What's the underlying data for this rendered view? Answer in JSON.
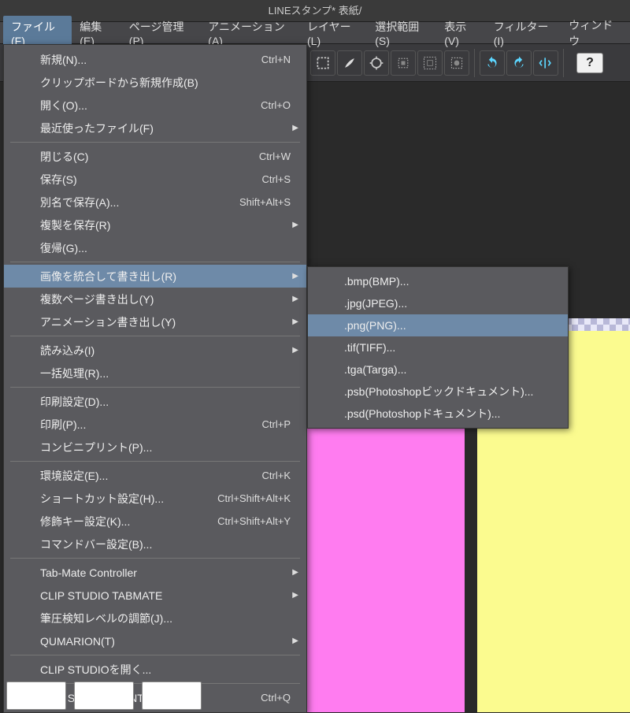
{
  "title": "LINEスタンプ* 表紙/",
  "menubar": {
    "items": [
      {
        "label": "ファイル(F)",
        "active": true
      },
      {
        "label": "編集(E)"
      },
      {
        "label": "ページ管理(P)"
      },
      {
        "label": "アニメーション(A)"
      },
      {
        "label": "レイヤー(L)"
      },
      {
        "label": "選択範囲(S)"
      },
      {
        "label": "表示(V)"
      },
      {
        "label": "フィルター(I)"
      },
      {
        "label": "ウィンドウ"
      }
    ]
  },
  "toolbar": {
    "icons": [
      "marquee-icon",
      "brush-icon",
      "free-transform-icon",
      "shrink-selection-icon",
      "expand-selection-icon",
      "quick-mask-icon"
    ],
    "icons2": [
      "rotate-left-icon",
      "rotate-right-icon",
      "flip-icon"
    ],
    "help": "?"
  },
  "file_menu": {
    "groups": [
      [
        {
          "label": "新規(N)...",
          "shortcut": "Ctrl+N"
        },
        {
          "label": "クリップボードから新規作成(B)"
        },
        {
          "label": "開く(O)...",
          "shortcut": "Ctrl+O"
        },
        {
          "label": "最近使ったファイル(F)",
          "submenu": true
        }
      ],
      [
        {
          "label": "閉じる(C)",
          "shortcut": "Ctrl+W"
        },
        {
          "label": "保存(S)",
          "shortcut": "Ctrl+S"
        },
        {
          "label": "別名で保存(A)...",
          "shortcut": "Shift+Alt+S"
        },
        {
          "label": "複製を保存(R)",
          "submenu": true
        },
        {
          "label": "復帰(G)..."
        }
      ],
      [
        {
          "label": "画像を統合して書き出し(R)",
          "submenu": true,
          "highlight": true
        },
        {
          "label": "複数ページ書き出し(Y)",
          "submenu": true
        },
        {
          "label": "アニメーション書き出し(Y)",
          "submenu": true
        }
      ],
      [
        {
          "label": "読み込み(I)",
          "submenu": true
        },
        {
          "label": "一括処理(R)..."
        }
      ],
      [
        {
          "label": "印刷設定(D)..."
        },
        {
          "label": "印刷(P)...",
          "shortcut": "Ctrl+P"
        },
        {
          "label": "コンビニプリント(P)..."
        }
      ],
      [
        {
          "label": "環境設定(E)...",
          "shortcut": "Ctrl+K"
        },
        {
          "label": "ショートカット設定(H)...",
          "shortcut": "Ctrl+Shift+Alt+K"
        },
        {
          "label": "修飾キー設定(K)...",
          "shortcut": "Ctrl+Shift+Alt+Y"
        },
        {
          "label": "コマンドバー設定(B)..."
        }
      ],
      [
        {
          "label": "Tab-Mate Controller",
          "submenu": true
        },
        {
          "label": "CLIP STUDIO TABMATE",
          "submenu": true
        },
        {
          "label": "筆圧検知レベルの調節(J)..."
        },
        {
          "label": "QUMARION(T)",
          "submenu": true
        }
      ],
      [
        {
          "label": "CLIP STUDIOを開く..."
        }
      ],
      [
        {
          "label": "CLIP STUDIO PAINT を終了(X)",
          "shortcut": "Ctrl+Q"
        }
      ]
    ]
  },
  "export_submenu": {
    "items": [
      {
        "label": ".bmp(BMP)..."
      },
      {
        "label": ".jpg(JPEG)..."
      },
      {
        "label": ".png(PNG)...",
        "highlight": true
      },
      {
        "label": ".tif(TIFF)..."
      },
      {
        "label": ".tga(Targa)..."
      },
      {
        "label": ".psb(Photoshopビックドキュメント)..."
      },
      {
        "label": ".psd(Photoshopドキュメント)..."
      }
    ]
  }
}
